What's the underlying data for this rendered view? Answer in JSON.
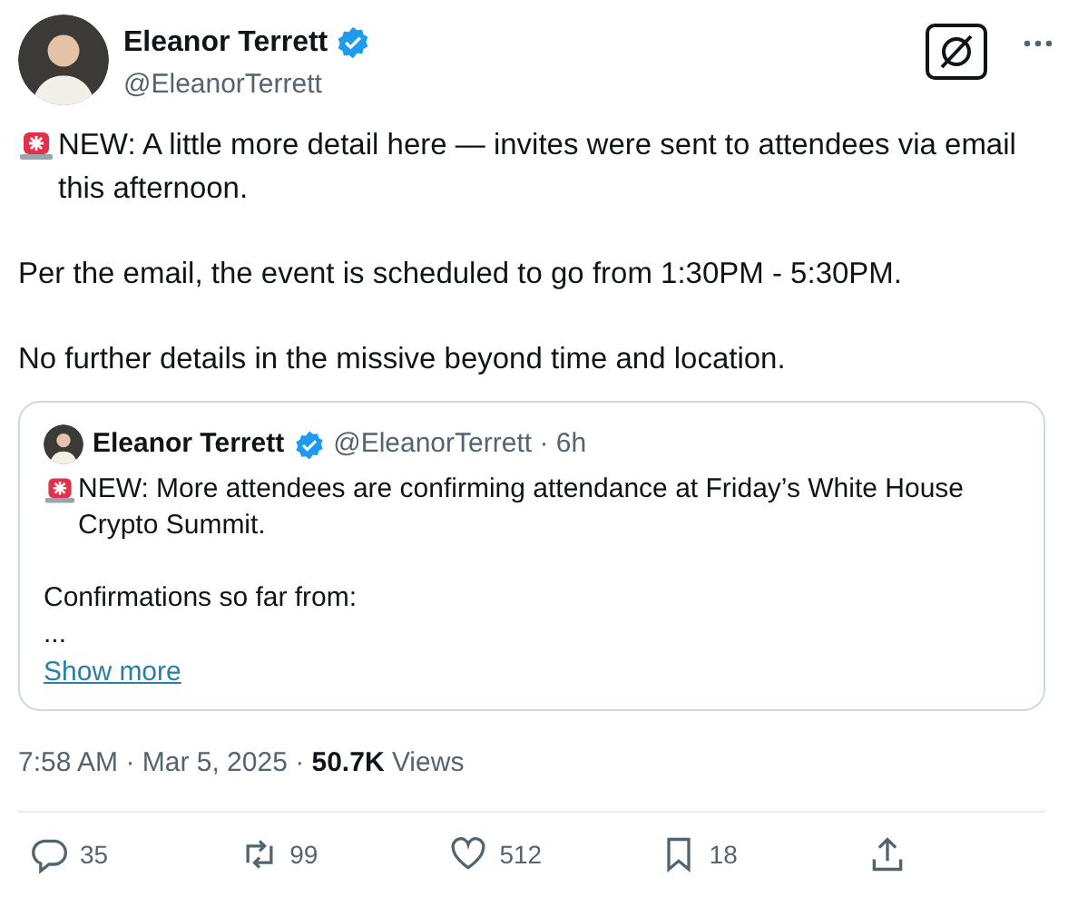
{
  "author": {
    "name": "Eleanor Terrett",
    "handle": "@EleanorTerrett",
    "verified": true
  },
  "paragraphs": [
    {
      "alert": true,
      "text": "NEW: A little more detail here — invites were sent to attendees via email this afternoon."
    },
    {
      "alert": false,
      "text": "Per the email, the event is scheduled to go from 1:30PM - 5:30PM."
    },
    {
      "alert": false,
      "text": "No further details in the missive beyond time and location."
    }
  ],
  "quote": {
    "name": "Eleanor Terrett",
    "verified": true,
    "handle": "@EleanorTerrett · 6h",
    "paragraphs": [
      {
        "alert": true,
        "text": "NEW: More attendees are confirming attendance at Friday’s White House Crypto Summit."
      },
      {
        "alert": false,
        "text": "Confirmations so far from:"
      },
      {
        "alert": false,
        "text": "..."
      }
    ],
    "show_more": "Show more"
  },
  "meta": "7:58 AM · Mar 5, 2025 · **50.7K** Views",
  "actions": [
    {
      "kind": "reply",
      "count": "35"
    },
    {
      "kind": "repost",
      "count": "99"
    },
    {
      "kind": "like",
      "count": "512"
    },
    {
      "kind": "bookmark",
      "count": "18"
    },
    {
      "kind": "share"
    }
  ]
}
